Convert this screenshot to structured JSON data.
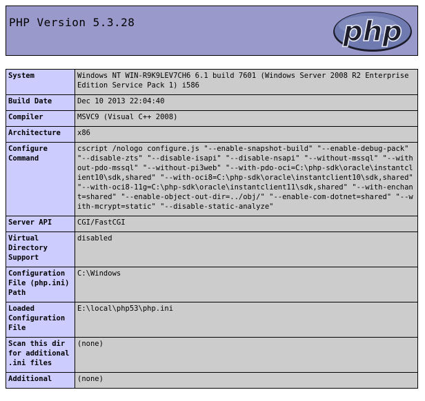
{
  "header": {
    "title": "PHP Version 5.3.28",
    "logo_text": "php",
    "logo_colors": {
      "fill": "#6f7ab0",
      "dark": "#1c1c2a",
      "highlight": "#e8ebf6"
    }
  },
  "colors": {
    "header_bg": "#9999cc",
    "label_bg": "#ccccff",
    "value_bg": "#cccccc",
    "border": "#000000"
  },
  "rows": [
    {
      "label": "System",
      "value": "Windows NT WIN-R9K9LEV7CH6 6.1 build 7601 (Windows Server 2008 R2 Enterprise Edition Service Pack 1) i586"
    },
    {
      "label": "Build Date",
      "value": "Dec 10 2013 22:04:40"
    },
    {
      "label": "Compiler",
      "value": "MSVC9 (Visual C++ 2008)"
    },
    {
      "label": "Architecture",
      "value": "x86"
    },
    {
      "label": "Configure Command",
      "value": "cscript /nologo configure.js \"--enable-snapshot-build\" \"--enable-debug-pack\" \"--disable-zts\" \"--disable-isapi\" \"--disable-nsapi\" \"--without-mssql\" \"--without-pdo-mssql\" \"--without-pi3web\" \"--with-pdo-oci=C:\\php-sdk\\oracle\\instantclient10\\sdk,shared\" \"--with-oci8=C:\\php-sdk\\oracle\\instantclient10\\sdk,shared\" \"--with-oci8-11g=C:\\php-sdk\\oracle\\instantclient11\\sdk,shared\" \"--with-enchant=shared\" \"--enable-object-out-dir=../obj/\" \"--enable-com-dotnet=shared\" \"--with-mcrypt=static\" \"--disable-static-analyze\""
    },
    {
      "label": "Server API",
      "value": "CGI/FastCGI"
    },
    {
      "label": "Virtual Directory Support",
      "value": "disabled"
    },
    {
      "label": "Configuration File (php.ini) Path",
      "value": "C:\\Windows"
    },
    {
      "label": "Loaded Configuration File",
      "value": "E:\\local\\php53\\php.ini"
    },
    {
      "label": "Scan this dir for additional .ini files",
      "value": "(none)"
    },
    {
      "label": "Additional",
      "value": "(none)"
    }
  ]
}
